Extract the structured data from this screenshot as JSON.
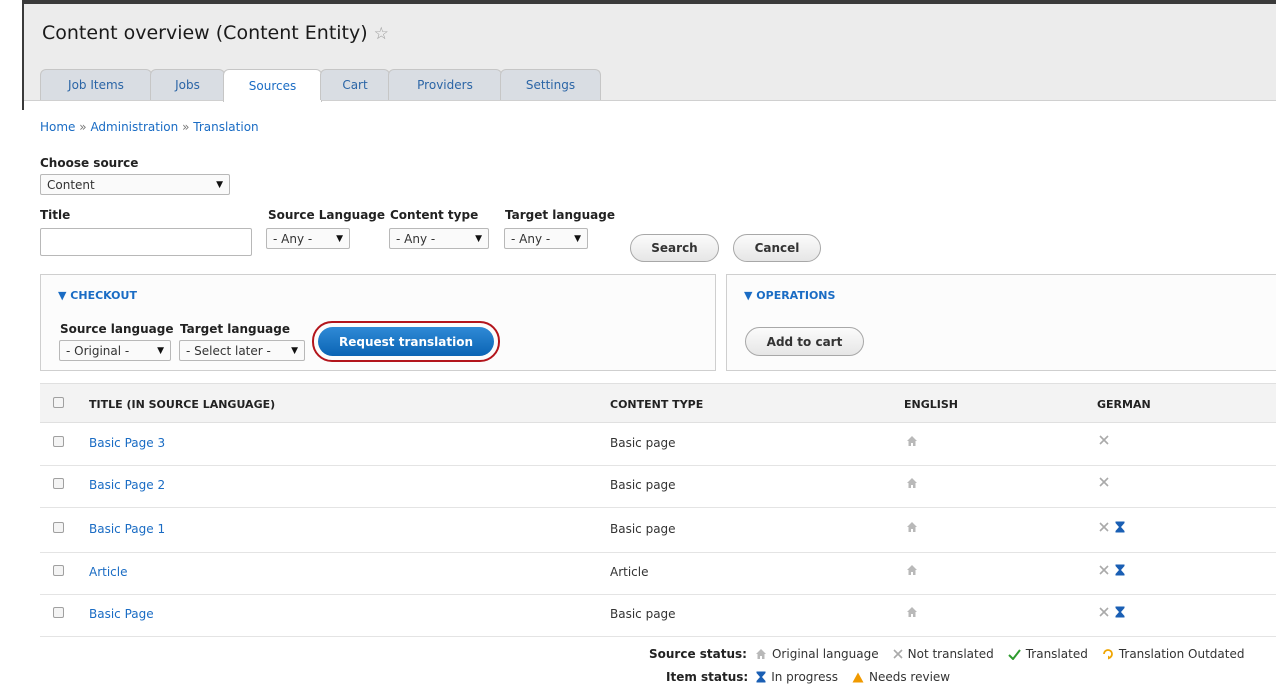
{
  "header": {
    "title": "Content overview (Content Entity)"
  },
  "tabs": [
    {
      "label": "Job Items"
    },
    {
      "label": "Jobs"
    },
    {
      "label": "Sources"
    },
    {
      "label": "Cart"
    },
    {
      "label": "Providers"
    },
    {
      "label": "Settings"
    }
  ],
  "active_tab": "Sources",
  "breadcrumb": [
    "Home",
    "Administration",
    "Translation"
  ],
  "breadcrumb_sep": "»",
  "filters": {
    "choose_source_label": "Choose source",
    "choose_source_value": "Content",
    "title_label": "Title",
    "title_value": "",
    "source_language_label": "Source Language",
    "source_language_value": "- Any -",
    "content_type_label": "Content type",
    "content_type_value": "- Any -",
    "target_language_label": "Target language",
    "target_language_value": "- Any -",
    "search_label": "Search",
    "cancel_label": "Cancel"
  },
  "checkout": {
    "title": "▼ CHECKOUT",
    "source_language_label": "Source language",
    "source_language_value": "- Original -",
    "target_language_label": "Target language",
    "target_language_value": "- Select later -",
    "request_label": "Request translation"
  },
  "operations": {
    "title": "▼ OPERATIONS",
    "add_to_cart_label": "Add to cart"
  },
  "table": {
    "columns": [
      "TITLE (IN SOURCE LANGUAGE)",
      "CONTENT TYPE",
      "ENGLISH",
      "GERMAN"
    ],
    "rows": [
      {
        "title": "Basic Page 3",
        "type": "Basic page",
        "english": "original",
        "german": [
          "not-translated"
        ]
      },
      {
        "title": "Basic Page 2",
        "type": "Basic page",
        "english": "original",
        "german": [
          "not-translated"
        ]
      },
      {
        "title": "Basic Page 1",
        "type": "Basic page",
        "english": "original",
        "german": [
          "not-translated",
          "in-progress"
        ]
      },
      {
        "title": "Article",
        "type": "Article",
        "english": "original",
        "german": [
          "not-translated",
          "in-progress"
        ]
      },
      {
        "title": "Basic Page",
        "type": "Basic page",
        "english": "original",
        "german": [
          "not-translated",
          "in-progress"
        ]
      }
    ]
  },
  "legend": {
    "source_status_label": "Source status:",
    "source_items": [
      "Original language",
      "Not translated",
      "Translated",
      "Translation Outdated"
    ],
    "item_status_label": "Item status:",
    "item_items": [
      "In progress",
      "Needs review"
    ]
  },
  "colors": {
    "link": "#1a6cc4",
    "primary_button": "#0b64b4",
    "highlight_ring": "#b3151c",
    "translated": "#2e9b2e",
    "outdated": "#f0a500",
    "in_progress": "#1a5fb4",
    "needs_review": "#f09a00"
  }
}
